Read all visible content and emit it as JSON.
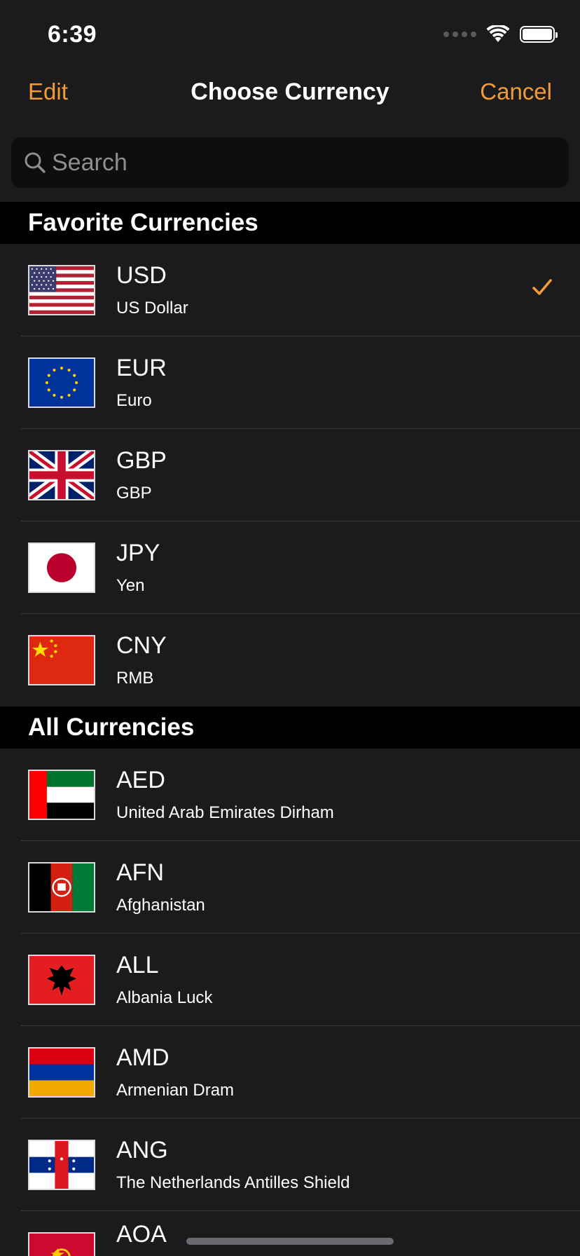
{
  "status": {
    "time": "6:39"
  },
  "nav": {
    "edit_label": "Edit",
    "title": "Choose Currency",
    "cancel_label": "Cancel"
  },
  "search": {
    "placeholder": "Search"
  },
  "sections": [
    {
      "title": "Favorite Currencies"
    },
    {
      "title": "All Currencies"
    }
  ],
  "favorites": [
    {
      "code": "USD",
      "name": "US Dollar",
      "flag": "flag-us-icon",
      "selected": true
    },
    {
      "code": "EUR",
      "name": "Euro",
      "flag": "flag-eu-icon"
    },
    {
      "code": "GBP",
      "name": "GBP",
      "flag": "flag-gb-icon"
    },
    {
      "code": "JPY",
      "name": "Yen",
      "flag": "flag-jp-icon"
    },
    {
      "code": "CNY",
      "name": "RMB",
      "flag": "flag-cn-icon"
    }
  ],
  "all": [
    {
      "code": "AED",
      "name": "United Arab Emirates Dirham",
      "flag": "flag-ae-icon"
    },
    {
      "code": "AFN",
      "name": "Afghanistan",
      "flag": "flag-af-icon"
    },
    {
      "code": "ALL",
      "name": "Albania Luck",
      "flag": "flag-al-icon"
    },
    {
      "code": "AMD",
      "name": "Armenian Dram",
      "flag": "flag-am-icon"
    },
    {
      "code": "ANG",
      "name": "The Netherlands Antilles Shield",
      "flag": "flag-an-icon"
    },
    {
      "code": "AOA",
      "name": "",
      "flag": "flag-ao-icon"
    }
  ],
  "colors": {
    "accent": "#f29b38",
    "background": "#1b1b1d",
    "section_header": "#000000"
  }
}
